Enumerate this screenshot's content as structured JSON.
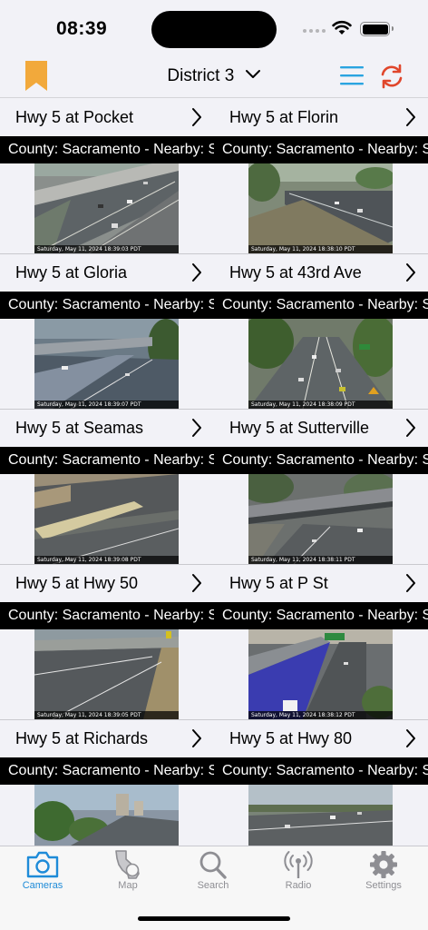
{
  "status": {
    "time": "08:39"
  },
  "nav": {
    "title": "District 3"
  },
  "county_text": "County: Sacramento - Nearby: S",
  "rows": [
    {
      "left": {
        "name": "Hwy 5 at Pocket",
        "timestamp": "Saturday, May 11, 2024  18:39:03 PDT"
      },
      "right": {
        "name": "Hwy 5 at Florin",
        "timestamp": "Saturday, May 11, 2024  18:38:10 PDT"
      }
    },
    {
      "left": {
        "name": "Hwy 5 at Gloria",
        "timestamp": "Saturday, May 11, 2024  18:39:07 PDT"
      },
      "right": {
        "name": "Hwy 5 at 43rd Ave",
        "timestamp": "Saturday, May 11, 2024  18:38:09 PDT"
      }
    },
    {
      "left": {
        "name": "Hwy 5 at Seamas",
        "timestamp": "Saturday, May 11, 2024  18:39:08 PDT"
      },
      "right": {
        "name": "Hwy 5 at Sutterville",
        "timestamp": "Saturday, May 11, 2024  18:38:11 PDT"
      }
    },
    {
      "left": {
        "name": "Hwy 5 at Hwy 50",
        "timestamp": "Saturday, May 11, 2024  18:39:05 PDT"
      },
      "right": {
        "name": "Hwy 5 at P St",
        "timestamp": "Saturday, May 11, 2024  18:38:12 PDT"
      }
    },
    {
      "left": {
        "name": "Hwy 5 at Richards",
        "timestamp": ""
      },
      "right": {
        "name": "Hwy 5 at Hwy 80",
        "timestamp": ""
      }
    }
  ],
  "tabs": [
    {
      "label": "Cameras",
      "icon": "camera-icon",
      "active": true
    },
    {
      "label": "Map",
      "icon": "ca-map-icon",
      "active": false
    },
    {
      "label": "Search",
      "icon": "search-icon",
      "active": false
    },
    {
      "label": "Radio",
      "icon": "radio-icon",
      "active": false
    },
    {
      "label": "Settings",
      "icon": "settings-icon",
      "active": false
    }
  ],
  "colors": {
    "accent": "#1e8bd8",
    "bookmark": "#f2a93b",
    "refresh": "#e0462b",
    "inactive_tab": "#8e8e93"
  }
}
